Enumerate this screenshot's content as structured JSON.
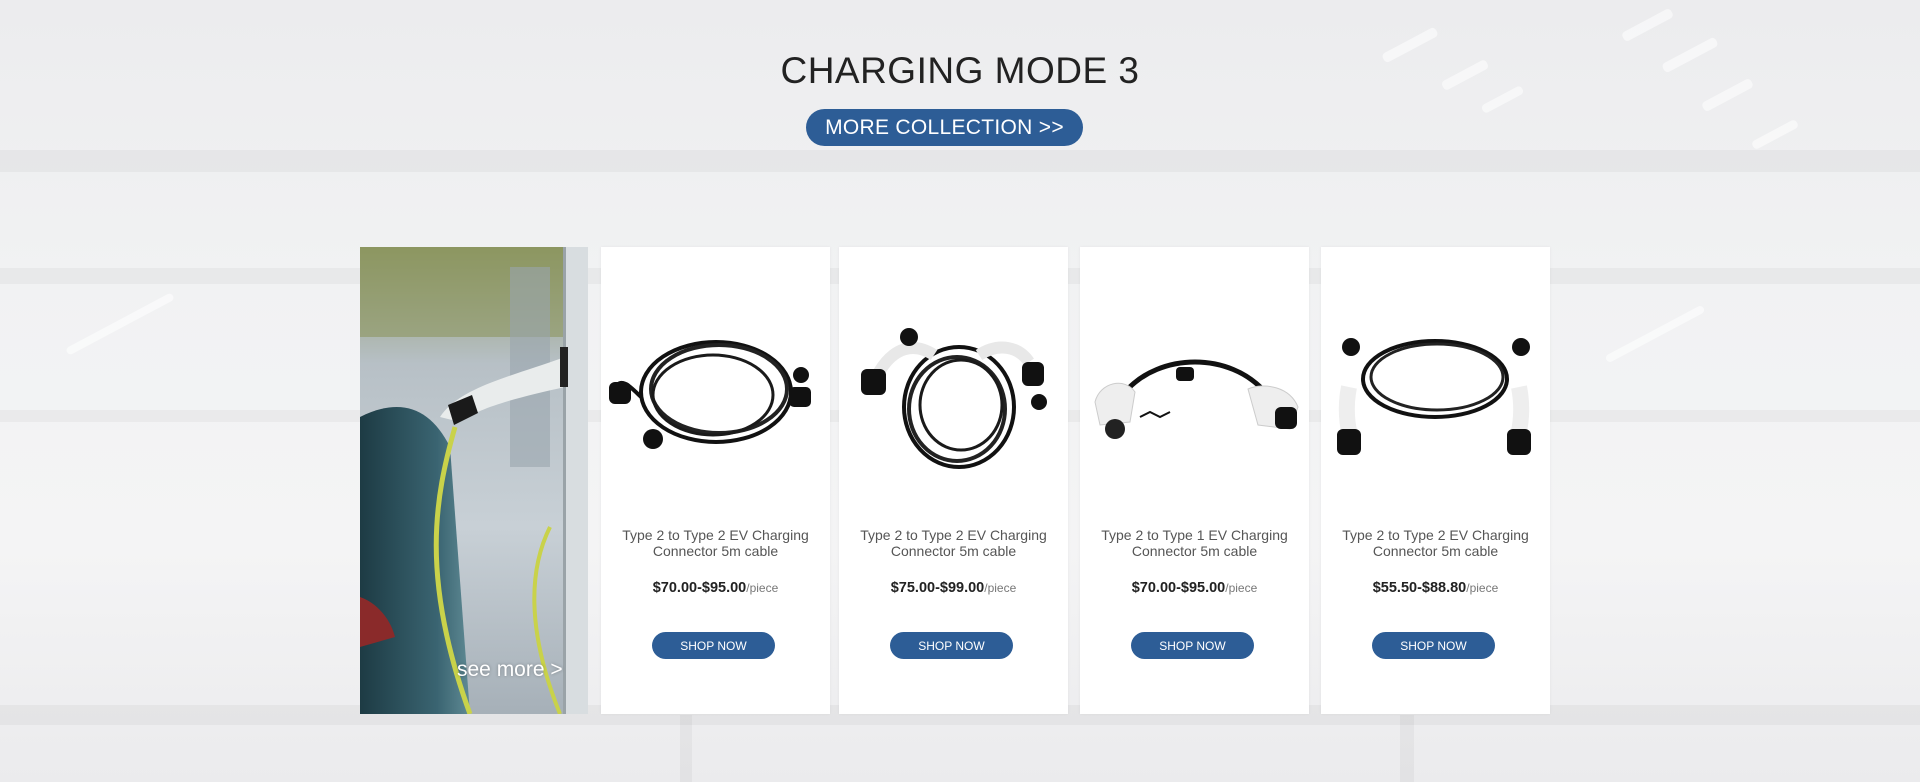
{
  "section": {
    "title": "CHARGING MODE 3",
    "more_button": "MORE COLLECTION >>"
  },
  "promo": {
    "label": "see more >"
  },
  "products": [
    {
      "name": "Type 2 to Type 2  EV Charging Connector 5m cable",
      "price": "$70.00-$95.00",
      "unit": "/piece",
      "button": "SHOP NOW"
    },
    {
      "name": "Type 2 to Type 2  EV Charging Connector 5m cable",
      "price": "$75.00-$99.00",
      "unit": "/piece",
      "button": "SHOP NOW"
    },
    {
      "name": "Type 2 to Type 1 EV Charging Connector 5m cable",
      "price": "$70.00-$95.00",
      "unit": "/piece",
      "button": "SHOP NOW"
    },
    {
      "name": "Type 2 to Type 2  EV Charging Connector 5m cable",
      "price": "$55.50-$88.80",
      "unit": "/piece",
      "button": "SHOP NOW"
    }
  ],
  "colors": {
    "accent": "#2d5d96",
    "text": "#222222",
    "muted": "#555555"
  }
}
